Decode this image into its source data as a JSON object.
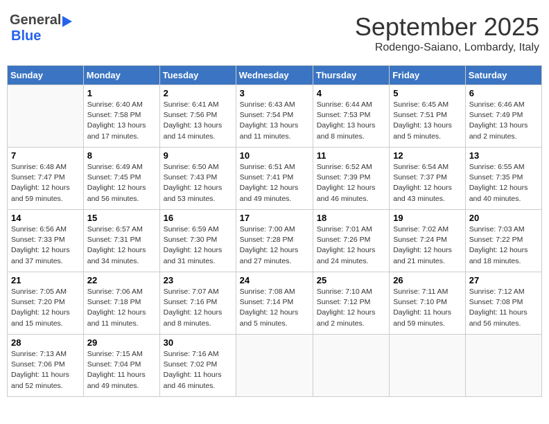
{
  "header": {
    "logo_general": "General",
    "logo_blue": "Blue",
    "month_title": "September 2025",
    "location": "Rodengo-Saiano, Lombardy, Italy"
  },
  "weekdays": [
    "Sunday",
    "Monday",
    "Tuesday",
    "Wednesday",
    "Thursday",
    "Friday",
    "Saturday"
  ],
  "weeks": [
    [
      {
        "day": "",
        "sunrise": "",
        "sunset": "",
        "daylight": ""
      },
      {
        "day": "1",
        "sunrise": "Sunrise: 6:40 AM",
        "sunset": "Sunset: 7:58 PM",
        "daylight": "Daylight: 13 hours and 17 minutes."
      },
      {
        "day": "2",
        "sunrise": "Sunrise: 6:41 AM",
        "sunset": "Sunset: 7:56 PM",
        "daylight": "Daylight: 13 hours and 14 minutes."
      },
      {
        "day": "3",
        "sunrise": "Sunrise: 6:43 AM",
        "sunset": "Sunset: 7:54 PM",
        "daylight": "Daylight: 13 hours and 11 minutes."
      },
      {
        "day": "4",
        "sunrise": "Sunrise: 6:44 AM",
        "sunset": "Sunset: 7:53 PM",
        "daylight": "Daylight: 13 hours and 8 minutes."
      },
      {
        "day": "5",
        "sunrise": "Sunrise: 6:45 AM",
        "sunset": "Sunset: 7:51 PM",
        "daylight": "Daylight: 13 hours and 5 minutes."
      },
      {
        "day": "6",
        "sunrise": "Sunrise: 6:46 AM",
        "sunset": "Sunset: 7:49 PM",
        "daylight": "Daylight: 13 hours and 2 minutes."
      }
    ],
    [
      {
        "day": "7",
        "sunrise": "Sunrise: 6:48 AM",
        "sunset": "Sunset: 7:47 PM",
        "daylight": "Daylight: 12 hours and 59 minutes."
      },
      {
        "day": "8",
        "sunrise": "Sunrise: 6:49 AM",
        "sunset": "Sunset: 7:45 PM",
        "daylight": "Daylight: 12 hours and 56 minutes."
      },
      {
        "day": "9",
        "sunrise": "Sunrise: 6:50 AM",
        "sunset": "Sunset: 7:43 PM",
        "daylight": "Daylight: 12 hours and 53 minutes."
      },
      {
        "day": "10",
        "sunrise": "Sunrise: 6:51 AM",
        "sunset": "Sunset: 7:41 PM",
        "daylight": "Daylight: 12 hours and 49 minutes."
      },
      {
        "day": "11",
        "sunrise": "Sunrise: 6:52 AM",
        "sunset": "Sunset: 7:39 PM",
        "daylight": "Daylight: 12 hours and 46 minutes."
      },
      {
        "day": "12",
        "sunrise": "Sunrise: 6:54 AM",
        "sunset": "Sunset: 7:37 PM",
        "daylight": "Daylight: 12 hours and 43 minutes."
      },
      {
        "day": "13",
        "sunrise": "Sunrise: 6:55 AM",
        "sunset": "Sunset: 7:35 PM",
        "daylight": "Daylight: 12 hours and 40 minutes."
      }
    ],
    [
      {
        "day": "14",
        "sunrise": "Sunrise: 6:56 AM",
        "sunset": "Sunset: 7:33 PM",
        "daylight": "Daylight: 12 hours and 37 minutes."
      },
      {
        "day": "15",
        "sunrise": "Sunrise: 6:57 AM",
        "sunset": "Sunset: 7:31 PM",
        "daylight": "Daylight: 12 hours and 34 minutes."
      },
      {
        "day": "16",
        "sunrise": "Sunrise: 6:59 AM",
        "sunset": "Sunset: 7:30 PM",
        "daylight": "Daylight: 12 hours and 31 minutes."
      },
      {
        "day": "17",
        "sunrise": "Sunrise: 7:00 AM",
        "sunset": "Sunset: 7:28 PM",
        "daylight": "Daylight: 12 hours and 27 minutes."
      },
      {
        "day": "18",
        "sunrise": "Sunrise: 7:01 AM",
        "sunset": "Sunset: 7:26 PM",
        "daylight": "Daylight: 12 hours and 24 minutes."
      },
      {
        "day": "19",
        "sunrise": "Sunrise: 7:02 AM",
        "sunset": "Sunset: 7:24 PM",
        "daylight": "Daylight: 12 hours and 21 minutes."
      },
      {
        "day": "20",
        "sunrise": "Sunrise: 7:03 AM",
        "sunset": "Sunset: 7:22 PM",
        "daylight": "Daylight: 12 hours and 18 minutes."
      }
    ],
    [
      {
        "day": "21",
        "sunrise": "Sunrise: 7:05 AM",
        "sunset": "Sunset: 7:20 PM",
        "daylight": "Daylight: 12 hours and 15 minutes."
      },
      {
        "day": "22",
        "sunrise": "Sunrise: 7:06 AM",
        "sunset": "Sunset: 7:18 PM",
        "daylight": "Daylight: 12 hours and 11 minutes."
      },
      {
        "day": "23",
        "sunrise": "Sunrise: 7:07 AM",
        "sunset": "Sunset: 7:16 PM",
        "daylight": "Daylight: 12 hours and 8 minutes."
      },
      {
        "day": "24",
        "sunrise": "Sunrise: 7:08 AM",
        "sunset": "Sunset: 7:14 PM",
        "daylight": "Daylight: 12 hours and 5 minutes."
      },
      {
        "day": "25",
        "sunrise": "Sunrise: 7:10 AM",
        "sunset": "Sunset: 7:12 PM",
        "daylight": "Daylight: 12 hours and 2 minutes."
      },
      {
        "day": "26",
        "sunrise": "Sunrise: 7:11 AM",
        "sunset": "Sunset: 7:10 PM",
        "daylight": "Daylight: 11 hours and 59 minutes."
      },
      {
        "day": "27",
        "sunrise": "Sunrise: 7:12 AM",
        "sunset": "Sunset: 7:08 PM",
        "daylight": "Daylight: 11 hours and 56 minutes."
      }
    ],
    [
      {
        "day": "28",
        "sunrise": "Sunrise: 7:13 AM",
        "sunset": "Sunset: 7:06 PM",
        "daylight": "Daylight: 11 hours and 52 minutes."
      },
      {
        "day": "29",
        "sunrise": "Sunrise: 7:15 AM",
        "sunset": "Sunset: 7:04 PM",
        "daylight": "Daylight: 11 hours and 49 minutes."
      },
      {
        "day": "30",
        "sunrise": "Sunrise: 7:16 AM",
        "sunset": "Sunset: 7:02 PM",
        "daylight": "Daylight: 11 hours and 46 minutes."
      },
      {
        "day": "",
        "sunrise": "",
        "sunset": "",
        "daylight": ""
      },
      {
        "day": "",
        "sunrise": "",
        "sunset": "",
        "daylight": ""
      },
      {
        "day": "",
        "sunrise": "",
        "sunset": "",
        "daylight": ""
      },
      {
        "day": "",
        "sunrise": "",
        "sunset": "",
        "daylight": ""
      }
    ]
  ]
}
